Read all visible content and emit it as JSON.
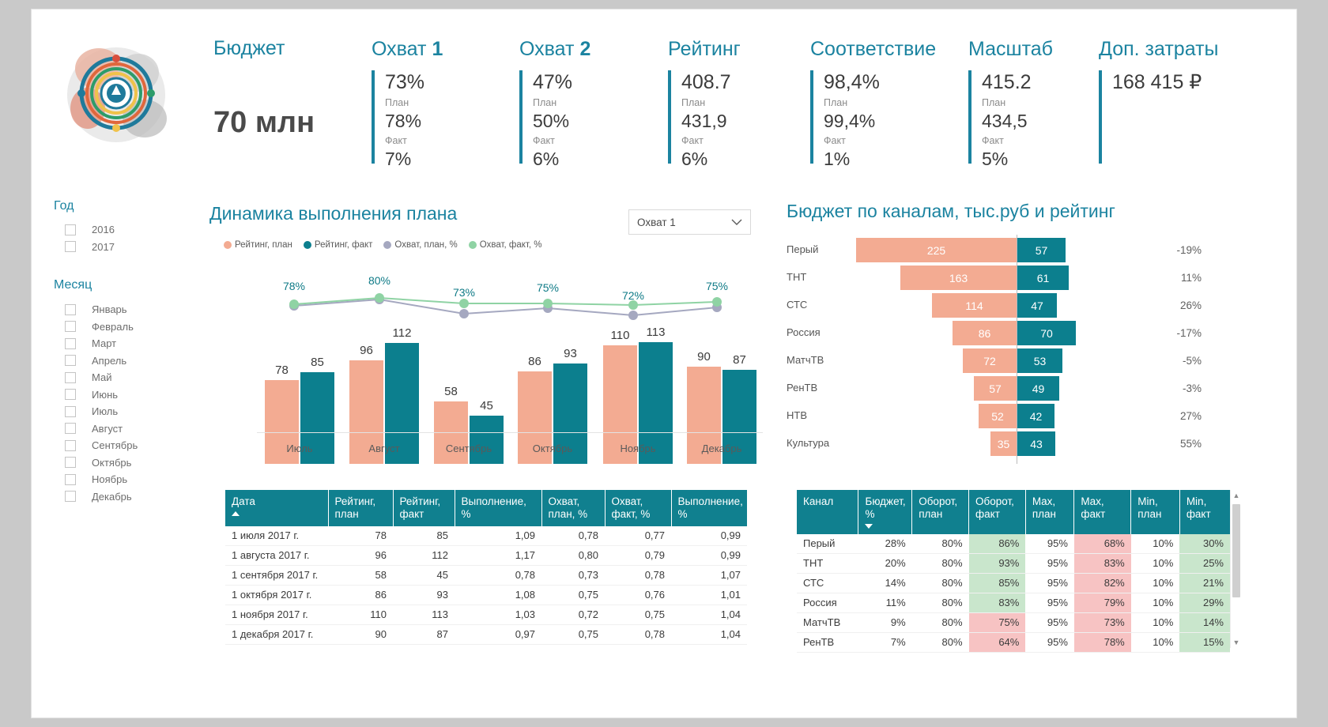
{
  "header": {
    "budget": {
      "title": "Бюджет",
      "value": "70 млн"
    },
    "kpis": [
      {
        "title_main": "Охват",
        "title_bold": "1",
        "value": "73%",
        "plan_label": "План",
        "plan_value": "78%",
        "fact_label": "Факт",
        "fact_value": "7%"
      },
      {
        "title_main": "Охват",
        "title_bold": "2",
        "value": "47%",
        "plan_label": "План",
        "plan_value": "50%",
        "fact_label": "Факт",
        "fact_value": "6%"
      },
      {
        "title_main": "Рейтинг",
        "title_bold": "",
        "value": "408.7",
        "plan_label": "План",
        "plan_value": "431,9",
        "fact_label": "Факт",
        "fact_value": "6%"
      },
      {
        "title_main": "Соответствие",
        "title_bold": "",
        "value": "98,4%",
        "plan_label": "План",
        "plan_value": "99,4%",
        "fact_label": "Факт",
        "fact_value": "1%"
      },
      {
        "title_main": "Масштаб",
        "title_bold": "",
        "value": "415.2",
        "plan_label": "План",
        "plan_value": "434,5",
        "fact_label": "Факт",
        "fact_value": "5%"
      },
      {
        "title_main": "Доп. затраты",
        "title_bold": "",
        "value": "168 415 ₽",
        "plan_label": "",
        "plan_value": "",
        "fact_label": "",
        "fact_value": ""
      }
    ]
  },
  "slicers": {
    "year": {
      "title": "Год",
      "items": [
        {
          "label": "2016",
          "checked": false
        },
        {
          "label": "2017",
          "checked": false
        }
      ]
    },
    "month": {
      "title": "Месяц",
      "items": [
        {
          "label": "Январь",
          "checked": false
        },
        {
          "label": "Февраль",
          "checked": false
        },
        {
          "label": "Март",
          "checked": false
        },
        {
          "label": "Апрель",
          "checked": false
        },
        {
          "label": "Май",
          "checked": false
        },
        {
          "label": "Июнь",
          "checked": false
        },
        {
          "label": "Июль",
          "checked": false
        },
        {
          "label": "Август",
          "checked": false
        },
        {
          "label": "Сентябрь",
          "checked": false
        },
        {
          "label": "Октябрь",
          "checked": false
        },
        {
          "label": "Ноябрь",
          "checked": false
        },
        {
          "label": "Декабрь",
          "checked": false
        }
      ]
    }
  },
  "combo_panel": {
    "title": "Динамика выполнения плана",
    "dropdown_value": "Охват 1",
    "dropdown_icon": "chevron-down-icon"
  },
  "funnel_panel": {
    "title": "Бюджет по каналам, тыс.руб и рейтинг"
  },
  "left_table": {
    "columns": [
      "Дата",
      "Рейтинг, план",
      "Рейтинг, факт",
      "Выполнение, %",
      "Охват, план, %",
      "Охват, факт, %",
      "Выполнение, %"
    ],
    "sort_column_index": 0,
    "sort_direction": "asc",
    "rows": [
      {
        "cells": [
          "1 июля 2017 г.",
          "78",
          "85",
          "1,09",
          "0,78",
          "0,77",
          "0,99"
        ],
        "flags": [
          "",
          "",
          "",
          "pos",
          "",
          "",
          "neg"
        ]
      },
      {
        "cells": [
          "1 августа 2017 г.",
          "96",
          "112",
          "1,17",
          "0,80",
          "0,79",
          "0,99"
        ],
        "flags": [
          "",
          "",
          "",
          "pos",
          "",
          "",
          "neg"
        ]
      },
      {
        "cells": [
          "1 сентября 2017 г.",
          "58",
          "45",
          "0,78",
          "0,73",
          "0,78",
          "1,07"
        ],
        "flags": [
          "",
          "",
          "",
          "neg",
          "",
          "",
          "pos"
        ]
      },
      {
        "cells": [
          "1 октября 2017 г.",
          "86",
          "93",
          "1,08",
          "0,75",
          "0,76",
          "1,01"
        ],
        "flags": [
          "",
          "",
          "",
          "pos",
          "",
          "",
          "pos"
        ]
      },
      {
        "cells": [
          "1 ноября 2017 г.",
          "110",
          "113",
          "1,03",
          "0,72",
          "0,75",
          "1,04"
        ],
        "flags": [
          "",
          "",
          "",
          "pos",
          "",
          "",
          "pos"
        ]
      },
      {
        "cells": [
          "1 декабря 2017 г.",
          "90",
          "87",
          "0,97",
          "0,75",
          "0,78",
          "1,04"
        ],
        "flags": [
          "",
          "",
          "",
          "neg",
          "",
          "",
          "pos"
        ]
      }
    ]
  },
  "right_table": {
    "columns": [
      "Канал",
      "Бюджет, %",
      "Оборот, план",
      "Оборот, факт",
      "Max, план",
      "Max, факт",
      "Min, план",
      "Min, факт"
    ],
    "sort_column_index": 1,
    "sort_direction": "desc",
    "rows": [
      {
        "cells": [
          "Перый",
          "28%",
          "80%",
          "86%",
          "95%",
          "68%",
          "10%",
          "30%"
        ],
        "fills": [
          "",
          "",
          "",
          "green",
          "",
          "red",
          "",
          "green"
        ]
      },
      {
        "cells": [
          "ТНТ",
          "20%",
          "80%",
          "93%",
          "95%",
          "83%",
          "10%",
          "25%"
        ],
        "fills": [
          "",
          "",
          "",
          "green",
          "",
          "red",
          "",
          "green"
        ]
      },
      {
        "cells": [
          "СТС",
          "14%",
          "80%",
          "85%",
          "95%",
          "82%",
          "10%",
          "21%"
        ],
        "fills": [
          "",
          "",
          "",
          "green",
          "",
          "red",
          "",
          "green"
        ]
      },
      {
        "cells": [
          "Россия",
          "11%",
          "80%",
          "83%",
          "95%",
          "79%",
          "10%",
          "29%"
        ],
        "fills": [
          "",
          "",
          "",
          "green",
          "",
          "red",
          "",
          "green"
        ]
      },
      {
        "cells": [
          "МатчТВ",
          "9%",
          "80%",
          "75%",
          "95%",
          "73%",
          "10%",
          "14%"
        ],
        "fills": [
          "",
          "",
          "",
          "red",
          "",
          "red",
          "",
          "green"
        ]
      },
      {
        "cells": [
          "РенТВ",
          "7%",
          "80%",
          "64%",
          "95%",
          "78%",
          "10%",
          "15%"
        ],
        "fills": [
          "",
          "",
          "",
          "red",
          "",
          "red",
          "",
          "green"
        ]
      }
    ]
  },
  "colors": {
    "accent": "#1b83a0",
    "plan_bar": "#f3ab92",
    "fact_bar": "#0c7f8e",
    "line_plan": "#a5a8c0",
    "line_fact": "#8fd3a4",
    "header_bg": "#10808f",
    "positive": "#9dc38f",
    "negative": "#f0706e"
  },
  "chart_data": [
    {
      "type": "bar",
      "id": "combo-chart",
      "title": "Динамика выполнения плана",
      "xlabel": "",
      "ylabel": "",
      "categories": [
        "Июль",
        "Август",
        "Сентябрь",
        "Октябрь",
        "Ноябрь",
        "Декабрь"
      ],
      "ylim": [
        0,
        120
      ],
      "grid": false,
      "legend": [
        "Рейтинг, план",
        "Рейтинг, факт",
        "Охват, план, %",
        "Охват, факт, %"
      ],
      "legend_position": "top-left",
      "series": [
        {
          "name": "Рейтинг, план",
          "type": "bar",
          "color": "#f3ab92",
          "values": [
            78,
            96,
            58,
            86,
            110,
            90
          ]
        },
        {
          "name": "Рейтинг, факт",
          "type": "bar",
          "color": "#0c7f8e",
          "values": [
            85,
            112,
            45,
            93,
            113,
            87
          ]
        },
        {
          "name": "Охват, план, %",
          "type": "line",
          "color": "#a5a8c0",
          "values": [
            78,
            80,
            73,
            75,
            72,
            75
          ]
        },
        {
          "name": "Охват, факт, %",
          "type": "line",
          "color": "#8fd3a4",
          "values": [
            78,
            80,
            73,
            75,
            72,
            75
          ],
          "labels": [
            "78%",
            "80%",
            "73%",
            "75%",
            "72%",
            "75%"
          ]
        }
      ]
    },
    {
      "type": "bar",
      "id": "channel-chart",
      "title": "Бюджет по каналам, тыс.руб и рейтинг",
      "orientation": "horizontal",
      "xlabel": "",
      "ylabel": "",
      "categories": [
        "Перый",
        "ТНТ",
        "СТС",
        "Россия",
        "МатчТВ",
        "РенТВ",
        "НТВ",
        "Культура"
      ],
      "series": [
        {
          "name": "Бюджет, тыс.руб",
          "color": "#f3ab92",
          "values": [
            225,
            163,
            114,
            86,
            72,
            57,
            52,
            35
          ]
        },
        {
          "name": "Рейтинг",
          "color": "#0c7f8e",
          "values": [
            57,
            61,
            47,
            70,
            53,
            49,
            42,
            43
          ]
        }
      ],
      "annotations": [
        "-19%",
        "11%",
        "26%",
        "-17%",
        "-5%",
        "-3%",
        "27%",
        "55%"
      ]
    }
  ]
}
